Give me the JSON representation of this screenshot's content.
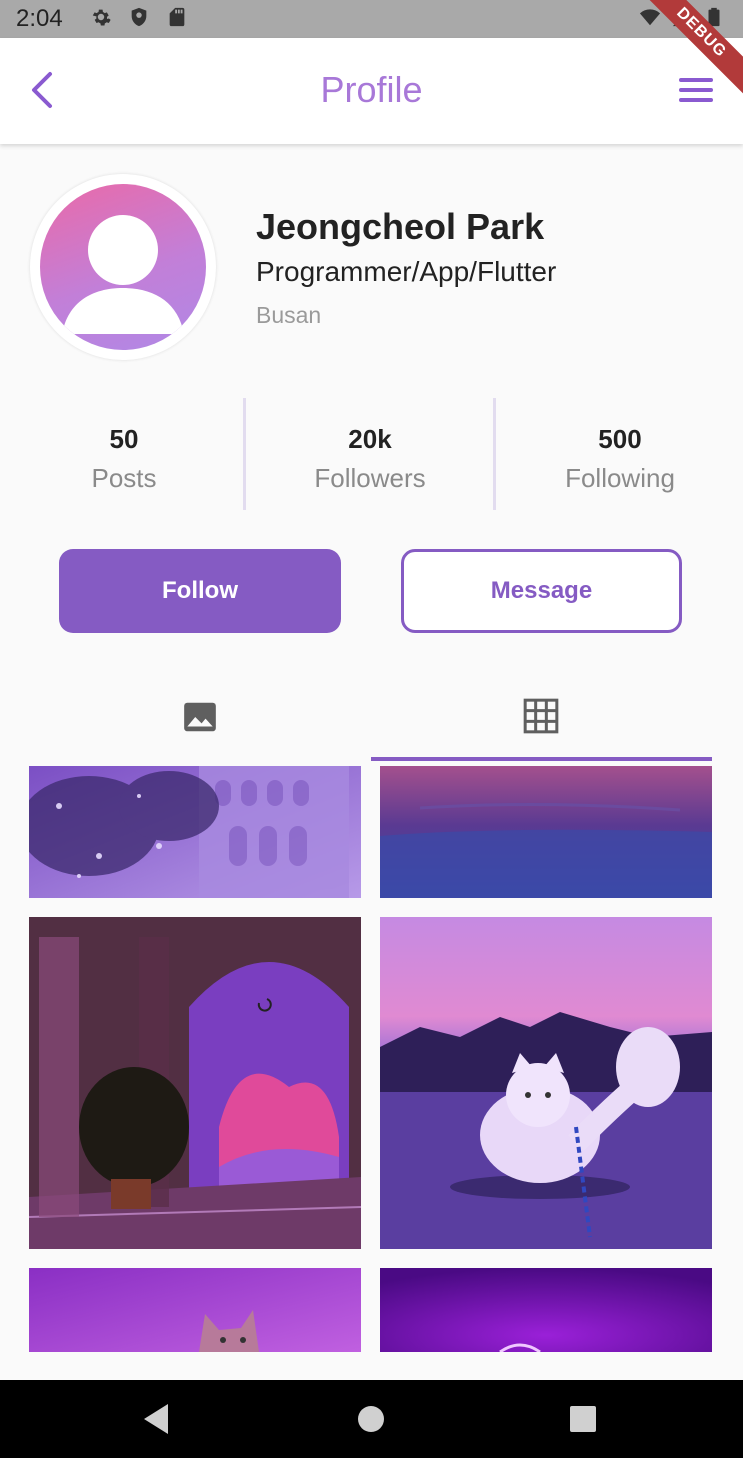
{
  "status_bar": {
    "time": "2:04"
  },
  "debug_banner": "DEBUG",
  "app_bar": {
    "title": "Profile"
  },
  "profile": {
    "name": "Jeongcheol Park",
    "role": "Programmer/App/Flutter",
    "location": "Busan"
  },
  "stats": [
    {
      "value": "50",
      "label": "Posts"
    },
    {
      "value": "20k",
      "label": "Followers"
    },
    {
      "value": "500",
      "label": "Following"
    }
  ],
  "actions": {
    "follow_label": "Follow",
    "message_label": "Message"
  },
  "tabs": [
    {
      "icon": "image-icon",
      "selected": false
    },
    {
      "icon": "grid-icon",
      "selected": true
    }
  ],
  "grid_images": [
    {
      "subject": "purple colosseum with flowers"
    },
    {
      "subject": "purple sky over sea"
    },
    {
      "subject": "pink cloud through archway"
    },
    {
      "subject": "white cat on purple evening"
    },
    {
      "subject": "kitten in purple light"
    },
    {
      "subject": "purple neon room"
    }
  ],
  "colors": {
    "accent": "#855bc3",
    "title": "#a878d8",
    "status_bar": "#a9a9a9"
  }
}
